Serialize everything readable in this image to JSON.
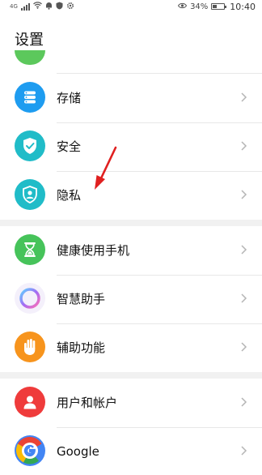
{
  "status_bar": {
    "network": "4G",
    "battery": "34%",
    "battery_level": 0.34,
    "time": "10:40"
  },
  "header": {
    "title": "设置"
  },
  "items": [
    {
      "label": "存储",
      "icon": "storage-icon",
      "color": "#1e9cf0"
    },
    {
      "label": "安全",
      "icon": "security-shield-icon",
      "color": "#20bcc8"
    },
    {
      "label": "隐私",
      "icon": "privacy-icon",
      "color": "#20bcc8"
    },
    {
      "label": "健康使用手机",
      "icon": "hourglass-icon",
      "color": "#46c35a"
    },
    {
      "label": "智慧助手",
      "icon": "smart-assistant-icon",
      "color": "#9a7cf0"
    },
    {
      "label": "辅助功能",
      "icon": "hand-icon",
      "color": "#f7941d"
    },
    {
      "label": "用户和帐户",
      "icon": "user-icon",
      "color": "#ef3b3b"
    },
    {
      "label": "Google",
      "icon": "google-icon",
      "color": "#4285f4"
    }
  ]
}
